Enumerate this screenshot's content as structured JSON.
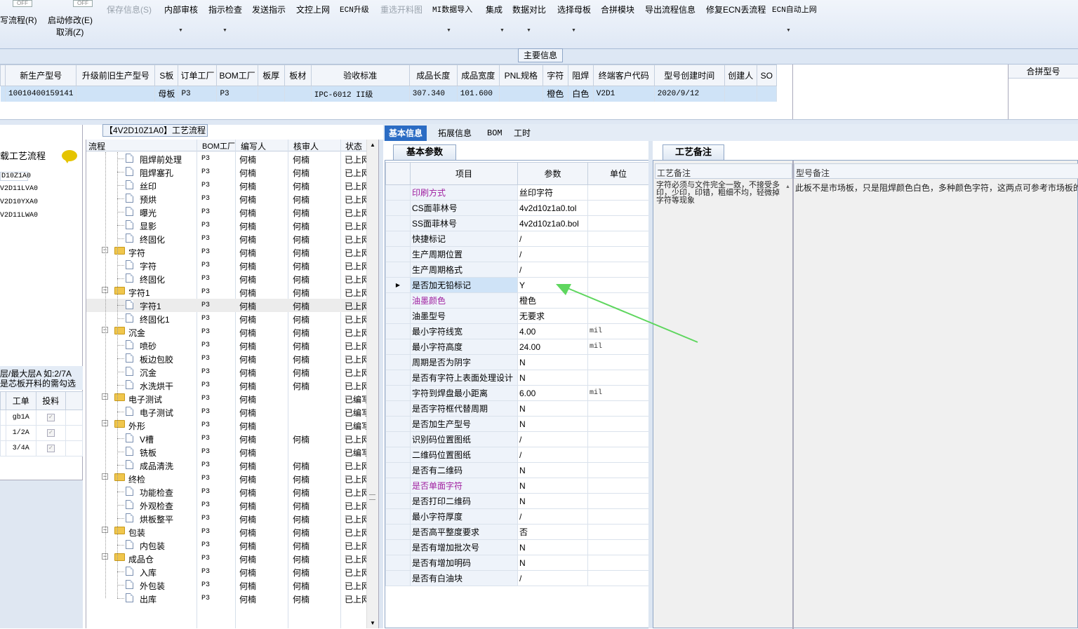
{
  "toolbar": {
    "toggle_labels": [
      "OFF",
      "OFF"
    ],
    "left_cut": "写流程(R)",
    "auto_modify": "启动修改(E)",
    "cancel": "取消(Z)",
    "buttons": [
      {
        "label": "保存信息(S)",
        "disabled": true
      },
      {
        "label": "内部审核",
        "dropdown": true
      },
      {
        "label": "指示检查",
        "dropdown": true
      },
      {
        "label": "发送指示"
      },
      {
        "label": "文控上网"
      },
      {
        "label": "ECN升级"
      },
      {
        "label": "重选开料图",
        "disabled": true
      },
      {
        "label": "MI数据导入",
        "dropdown": true
      },
      {
        "label": "集成",
        "dropdown": true
      },
      {
        "label": "数据对比",
        "dropdown": true
      },
      {
        "label": "选择母板",
        "dropdown": true
      },
      {
        "label": "合拼模块"
      },
      {
        "label": "导出流程信息"
      },
      {
        "label": "修复ECN丢流程"
      },
      {
        "label": "ECN自动上网",
        "dropdown": true
      }
    ]
  },
  "main_info": {
    "tab_label": "主要信息",
    "columns": [
      "新生产型号",
      "升级前旧生产型号",
      "S板",
      "订单工厂",
      "BOM工厂",
      "板厚",
      "板材",
      "验收标准",
      "成品长度",
      "成品宽度",
      "PNL规格",
      "字符",
      "阻焊",
      "终端客户代码",
      "型号创建时间",
      "创建人",
      "SO"
    ],
    "row": [
      "10010400159141",
      "",
      "母板",
      "P3",
      "P3",
      "",
      "",
      "IPC-6012 II级",
      "307.340",
      "101.600",
      "",
      "橙色",
      "白色",
      "V2D1",
      "2020/9/12",
      "",
      ""
    ],
    "merge_title": "合拼型号"
  },
  "left_panel": {
    "title": "载工艺流程",
    "items": [
      "D10Z1A0",
      "V2D11LVA0",
      "V2D10YXA0",
      "V2D11LWA0"
    ],
    "note_lines": [
      "层/最大层A 如:2/7A",
      "是芯板开料的需勾选"
    ],
    "grid_headers": [
      "工单",
      "投料"
    ],
    "grid_rows": [
      "gb1A",
      "1/2A",
      "3/4A"
    ]
  },
  "process": {
    "tab_label": "【4V2D10Z1A0】工艺流程",
    "headers": [
      "流程",
      "BOM工厂",
      "编写人",
      "核审人",
      "状态"
    ],
    "rows": [
      {
        "name": "阻焊前处理",
        "type": "leaf",
        "bom": "P3",
        "editor": "何楠",
        "reviewer": "何楠",
        "status": "已上网"
      },
      {
        "name": "阻焊塞孔",
        "type": "leaf",
        "bom": "P3",
        "editor": "何楠",
        "reviewer": "何楠",
        "status": "已上网"
      },
      {
        "name": "丝印",
        "type": "leaf",
        "bom": "P3",
        "editor": "何楠",
        "reviewer": "何楠",
        "status": "已上网"
      },
      {
        "name": "预烘",
        "type": "leaf",
        "bom": "P3",
        "editor": "何楠",
        "reviewer": "何楠",
        "status": "已上网"
      },
      {
        "name": "曝光",
        "type": "leaf",
        "bom": "P3",
        "editor": "何楠",
        "reviewer": "何楠",
        "status": "已上网"
      },
      {
        "name": "显影",
        "type": "leaf",
        "bom": "P3",
        "editor": "何楠",
        "reviewer": "何楠",
        "status": "已上网"
      },
      {
        "name": "终固化",
        "type": "leaf",
        "bom": "P3",
        "editor": "何楠",
        "reviewer": "何楠",
        "status": "已上网"
      },
      {
        "name": "字符",
        "type": "folder",
        "bom": "P3",
        "editor": "何楠",
        "reviewer": "何楠",
        "status": "已上网"
      },
      {
        "name": "字符",
        "type": "leaf",
        "bom": "P3",
        "editor": "何楠",
        "reviewer": "何楠",
        "status": "已上网"
      },
      {
        "name": "终固化",
        "type": "leaf",
        "bom": "P3",
        "editor": "何楠",
        "reviewer": "何楠",
        "status": "已上网"
      },
      {
        "name": "字符1",
        "type": "folder",
        "bom": "P3",
        "editor": "何楠",
        "reviewer": "何楠",
        "status": "已上网"
      },
      {
        "name": "字符1",
        "type": "leaf",
        "bom": "P3",
        "editor": "何楠",
        "reviewer": "何楠",
        "status": "已上网",
        "selected": true
      },
      {
        "name": "终固化1",
        "type": "leaf",
        "bom": "P3",
        "editor": "何楠",
        "reviewer": "何楠",
        "status": "已上网"
      },
      {
        "name": "沉金",
        "type": "folder",
        "bom": "P3",
        "editor": "何楠",
        "reviewer": "何楠",
        "status": "已上网"
      },
      {
        "name": "喷砂",
        "type": "leaf",
        "bom": "P3",
        "editor": "何楠",
        "reviewer": "何楠",
        "status": "已上网"
      },
      {
        "name": "板边包胶",
        "type": "leaf",
        "bom": "P3",
        "editor": "何楠",
        "reviewer": "何楠",
        "status": "已上网"
      },
      {
        "name": "沉金",
        "type": "leaf",
        "bom": "P3",
        "editor": "何楠",
        "reviewer": "何楠",
        "status": "已上网"
      },
      {
        "name": "水洗烘干",
        "type": "leaf",
        "bom": "P3",
        "editor": "何楠",
        "reviewer": "何楠",
        "status": "已上网"
      },
      {
        "name": "电子测试",
        "type": "folder",
        "bom": "P3",
        "editor": "何楠",
        "reviewer": "",
        "status": "已编写"
      },
      {
        "name": "电子测试",
        "type": "leaf",
        "bom": "P3",
        "editor": "何楠",
        "reviewer": "",
        "status": "已编写"
      },
      {
        "name": "外形",
        "type": "folder",
        "bom": "P3",
        "editor": "何楠",
        "reviewer": "",
        "status": "已编写"
      },
      {
        "name": "V槽",
        "type": "leaf",
        "bom": "P3",
        "editor": "何楠",
        "reviewer": "何楠",
        "status": "已上网"
      },
      {
        "name": "铣板",
        "type": "leaf",
        "bom": "P3",
        "editor": "何楠",
        "reviewer": "",
        "status": "已编写"
      },
      {
        "name": "成品清洗",
        "type": "leaf",
        "bom": "P3",
        "editor": "何楠",
        "reviewer": "何楠",
        "status": "已上网"
      },
      {
        "name": "终检",
        "type": "folder",
        "bom": "P3",
        "editor": "何楠",
        "reviewer": "何楠",
        "status": "已上网"
      },
      {
        "name": "功能检查",
        "type": "leaf",
        "bom": "P3",
        "editor": "何楠",
        "reviewer": "何楠",
        "status": "已上网"
      },
      {
        "name": "外观检查",
        "type": "leaf",
        "bom": "P3",
        "editor": "何楠",
        "reviewer": "何楠",
        "status": "已上网"
      },
      {
        "name": "烘板整平",
        "type": "leaf",
        "bom": "P3",
        "editor": "何楠",
        "reviewer": "何楠",
        "status": "已上网"
      },
      {
        "name": "包装",
        "type": "folder",
        "bom": "P3",
        "editor": "何楠",
        "reviewer": "何楠",
        "status": "已上网"
      },
      {
        "name": "内包装",
        "type": "leaf",
        "bom": "P3",
        "editor": "何楠",
        "reviewer": "何楠",
        "status": "已上网"
      },
      {
        "name": "成品仓",
        "type": "folder",
        "bom": "P3",
        "editor": "何楠",
        "reviewer": "何楠",
        "status": "已上网"
      },
      {
        "name": "入库",
        "type": "leaf",
        "bom": "P3",
        "editor": "何楠",
        "reviewer": "何楠",
        "status": "已上网"
      },
      {
        "name": "外包装",
        "type": "leaf",
        "bom": "P3",
        "editor": "何楠",
        "reviewer": "何楠",
        "status": "已上网"
      },
      {
        "name": "出库",
        "type": "leaf",
        "bom": "P3",
        "editor": "何楠",
        "reviewer": "何楠",
        "status": "已上网"
      }
    ]
  },
  "right_tabs": [
    "基本信息",
    "拓展信息",
    "BOM",
    "工时"
  ],
  "basic_params": {
    "tab_label": "基本参数",
    "headers": [
      "项目",
      "参数",
      "单位"
    ],
    "rows": [
      {
        "item": "印刷方式",
        "value": "丝印字符",
        "unit": "",
        "purple": true
      },
      {
        "item": "CS面菲林号",
        "value": "4v2d10z1a0.tol",
        "unit": ""
      },
      {
        "item": "SS面菲林号",
        "value": "4v2d10z1a0.bol",
        "unit": ""
      },
      {
        "item": "快捷标记",
        "value": "/",
        "unit": ""
      },
      {
        "item": "生产周期位置",
        "value": "/",
        "unit": ""
      },
      {
        "item": "生产周期格式",
        "value": "/",
        "unit": ""
      },
      {
        "item": "是否加无铅标记",
        "value": "Y",
        "unit": "",
        "selected": true
      },
      {
        "item": "油墨颜色",
        "value": "橙色",
        "unit": "",
        "purple": true
      },
      {
        "item": "油墨型号",
        "value": "无要求",
        "unit": ""
      },
      {
        "item": "最小字符线宽",
        "value": "4.00",
        "unit": "mil"
      },
      {
        "item": "最小字符高度",
        "value": "24.00",
        "unit": "mil"
      },
      {
        "item": "周期是否为阴字",
        "value": "N",
        "unit": ""
      },
      {
        "item": "是否有字符上表面处理设计",
        "value": "N",
        "unit": ""
      },
      {
        "item": "字符到焊盘最小距离",
        "value": "6.00",
        "unit": "mil"
      },
      {
        "item": "是否字符框代替周期",
        "value": "N",
        "unit": ""
      },
      {
        "item": "是否加生产型号",
        "value": "N",
        "unit": ""
      },
      {
        "item": "识别码位置图纸",
        "value": "/",
        "unit": ""
      },
      {
        "item": "二维码位置图纸",
        "value": "/",
        "unit": ""
      },
      {
        "item": "是否有二维码",
        "value": "N",
        "unit": ""
      },
      {
        "item": "是否单面字符",
        "value": "N",
        "unit": "",
        "purple": true
      },
      {
        "item": "是否打印二维码",
        "value": "N",
        "unit": ""
      },
      {
        "item": "最小字符厚度",
        "value": "/",
        "unit": ""
      },
      {
        "item": "是否高平整度要求",
        "value": "否",
        "unit": ""
      },
      {
        "item": "是否有增加批次号",
        "value": "N",
        "unit": ""
      },
      {
        "item": "是否有增加明码",
        "value": "N",
        "unit": ""
      },
      {
        "item": "是否有白油块",
        "value": "/",
        "unit": ""
      }
    ]
  },
  "remarks": {
    "tab_label": "工艺备注",
    "col1_title": "工艺备注",
    "col2_title": "型号备注",
    "col1_text": "字符必须与文件完全一致，不接受多印，少印，印错，粗细不均，轻微掉字符等现象",
    "col2_text": "此板不是市场板，只是阻焊颜色白色，多种颜色字符，这两点可参考市场板的"
  },
  "annotation_color": "#5ed65e"
}
